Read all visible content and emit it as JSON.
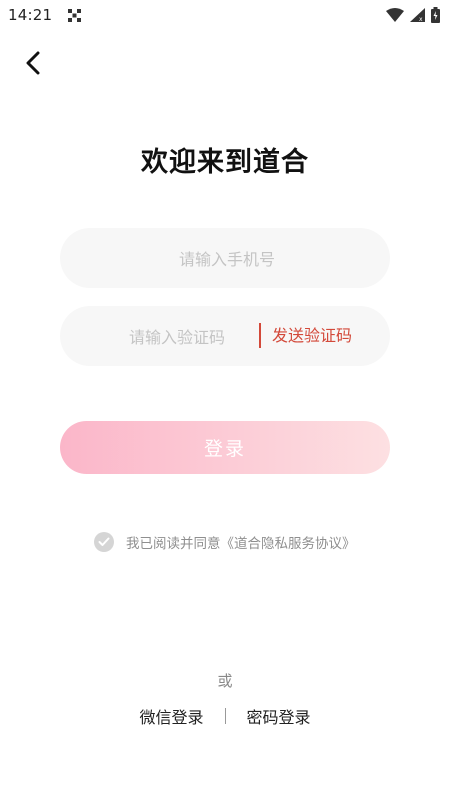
{
  "status_bar": {
    "time": "14:21",
    "icons": [
      "app-notification-icon",
      "wifi-icon",
      "cell-signal-icon",
      "battery-icon"
    ]
  },
  "header": {
    "back_icon": "chevron-left-icon"
  },
  "title": "欢迎来到道合",
  "form": {
    "phone_placeholder": "请输入手机号",
    "code_placeholder": "请输入验证码",
    "send_code_label": "发送验证码",
    "login_label": "登录"
  },
  "agreement": {
    "text": "我已阅读并同意《道合隐私服务协议》",
    "checked": false
  },
  "alternate": {
    "or_label": "或",
    "wechat_label": "微信登录",
    "password_label": "密码登录"
  },
  "colors": {
    "accent": "#d3493a",
    "button_gradient_start": "#fbb6c9",
    "button_gradient_end": "#fde0e2",
    "field_background": "#f7f7f7"
  }
}
